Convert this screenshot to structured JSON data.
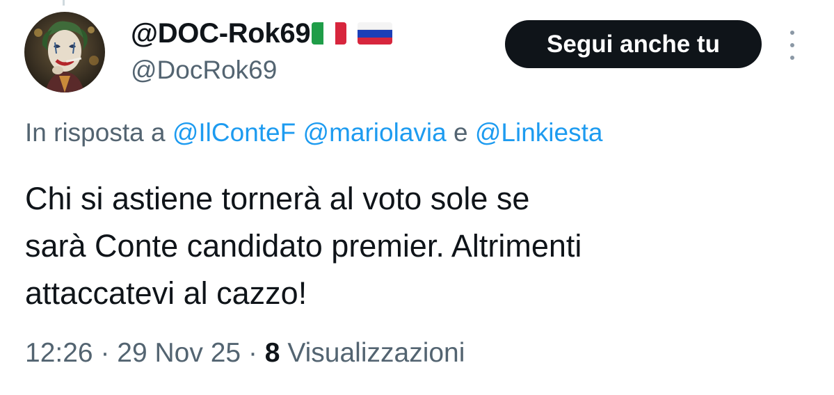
{
  "author": {
    "display_name": "@DOC-Rok69",
    "handle": "@DocRok69",
    "flags": [
      "italy-flag-emoji",
      "russia-flag-emoji"
    ]
  },
  "follow_button": {
    "label": "Segui anche tu"
  },
  "menu": {
    "icon": "vertical-ellipsis-icon"
  },
  "reply_context": {
    "prefix": "In risposta a",
    "mentions": [
      "@IlConteF",
      "@mariolavia",
      "@Linkiesta"
    ],
    "conjunction": "e"
  },
  "tweet": {
    "lines": [
      "Chi si astiene tornerà al voto sole se",
      "sarà Conte candidato premier. Altrimenti",
      "attaccatevi al cazzo!"
    ]
  },
  "meta": {
    "time": "12:26",
    "separator": "·",
    "date": "29 Nov 25",
    "views_count": "8",
    "views_label": "Visualizzazioni"
  },
  "colors": {
    "text": "#0f1419",
    "secondary": "#536471",
    "link": "#1d9bf0",
    "button_bg": "#0f1419",
    "button_text": "#ffffff"
  }
}
